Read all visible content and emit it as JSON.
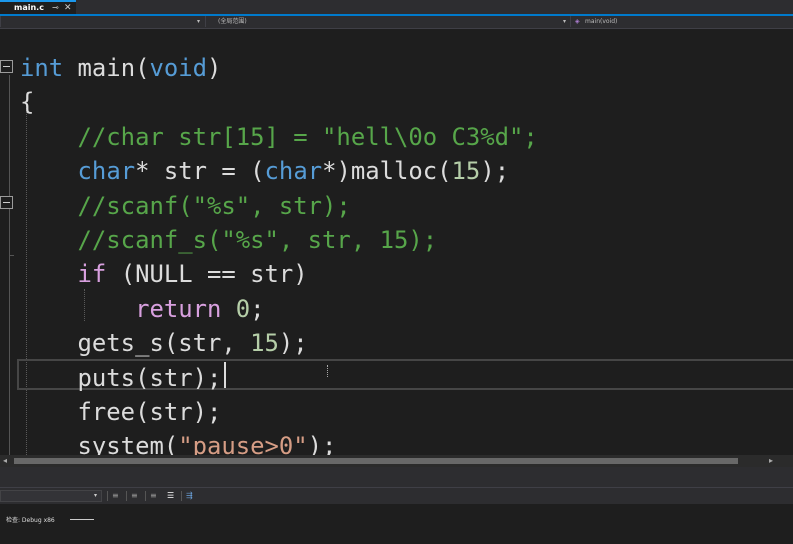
{
  "tab": {
    "filename": "main.c",
    "pin_glyph": "⊸",
    "close_glyph": "✕",
    "accent_color": "#007acc"
  },
  "navbar": {
    "project_scope": "",
    "global_scope": "(全局范围)",
    "function_scope": "main(void)",
    "function_icon": "purple-cube-icon"
  },
  "code": {
    "lines": [
      [
        {
          "t": "int",
          "c": "kw"
        },
        {
          "t": " main(",
          "c": "id"
        },
        {
          "t": "void",
          "c": "kw"
        },
        {
          "t": ")",
          "c": "id"
        }
      ],
      [
        {
          "t": "{",
          "c": "id"
        }
      ],
      [
        {
          "t": "    //char str[15] = \"hell\\0o C3%d\";",
          "c": "cm"
        }
      ],
      [
        {
          "t": "    ",
          "c": "id"
        },
        {
          "t": "char",
          "c": "kw"
        },
        {
          "t": "* str = (",
          "c": "id"
        },
        {
          "t": "char",
          "c": "kw"
        },
        {
          "t": "*)malloc(",
          "c": "id"
        },
        {
          "t": "15",
          "c": "num"
        },
        {
          "t": ");",
          "c": "id"
        }
      ],
      [
        {
          "t": "    //scanf(\"%s\", str);",
          "c": "cm"
        }
      ],
      [
        {
          "t": "    //scanf_s(\"%s\", str, 15);",
          "c": "cm"
        }
      ],
      [
        {
          "t": "    ",
          "c": "id"
        },
        {
          "t": "if",
          "c": "kw2"
        },
        {
          "t": " (NULL == str)",
          "c": "id"
        }
      ],
      [
        {
          "t": "        ",
          "c": "id"
        },
        {
          "t": "return",
          "c": "kw2"
        },
        {
          "t": " ",
          "c": "id"
        },
        {
          "t": "0",
          "c": "num"
        },
        {
          "t": ";",
          "c": "id"
        }
      ],
      [
        {
          "t": "    gets_s(str, ",
          "c": "id"
        },
        {
          "t": "15",
          "c": "num"
        },
        {
          "t": ");",
          "c": "id"
        }
      ],
      [
        {
          "t": "    puts(str);",
          "c": "id"
        }
      ],
      [
        {
          "t": "    free(str);",
          "c": "id"
        }
      ],
      [
        {
          "t": "    system(",
          "c": "id"
        },
        {
          "t": "\"pause>0\"",
          "c": "st"
        },
        {
          "t": ");",
          "c": "id"
        }
      ]
    ],
    "colors": {
      "keyword": "#569cd6",
      "control_keyword": "#d8a0df",
      "comment": "#57a64a",
      "string": "#d69d85",
      "number": "#b5cea8",
      "identifier": "#dcdcdc",
      "background": "#1e1e1e"
    }
  },
  "output": {
    "status_text": "检查: Debug x86",
    "toolbar_icons": [
      "align-left-icon",
      "align-center-icon",
      "word-wrap-icon",
      "clear-all-icon"
    ]
  }
}
